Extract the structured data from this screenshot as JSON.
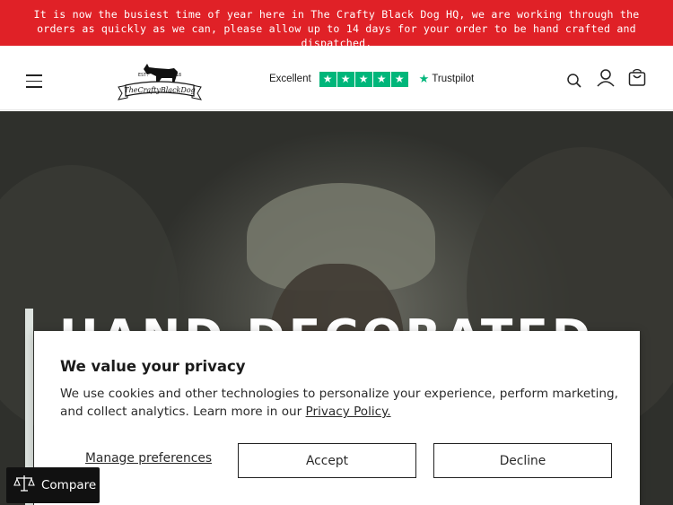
{
  "announcement": {
    "text": "It is now the busiest time of year here in The Crafty Black Dog HQ, we are working through the orders as quickly as we can, please allow up to 14 days for your order to be hand crafted and dispatched."
  },
  "header": {
    "logo": {
      "est": "EST.",
      "year": "2018",
      "brand": "TheCraftyBlackDog"
    },
    "trustpilot": {
      "rating_label": "Excellent",
      "stars": 5,
      "brand": "Trustpilot"
    },
    "icons": [
      "menu-icon",
      "search-icon",
      "account-icon",
      "cart-icon"
    ]
  },
  "hero": {
    "heading": "HAND DECORATED"
  },
  "cookie_banner": {
    "title": "We value your privacy",
    "body": "We use cookies and other technologies to personalize your experience, perform marketing, and collect analytics. Learn more in our ",
    "link_text": "Privacy Policy.",
    "manage_label": "Manage preferences",
    "accept_label": "Accept",
    "decline_label": "Decline"
  },
  "compare_widget": {
    "label": "Compare"
  },
  "colors": {
    "announcement_bg": "#e02127",
    "trustpilot_green": "#00b67a",
    "compare_bg": "#111111"
  }
}
